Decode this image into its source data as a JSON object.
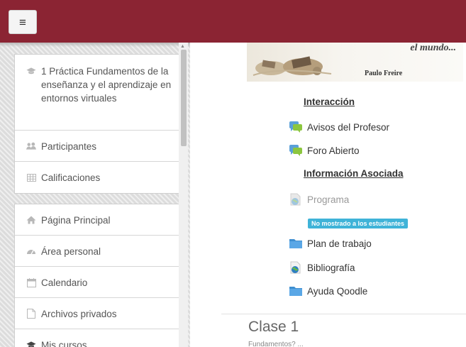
{
  "topbar": {
    "menu_icon": "hamburger-icon",
    "menu_glyph": "≡",
    "color": "#8b2433"
  },
  "sidebar": {
    "course_block": [
      {
        "label": "1 Práctica Fundamentos de la enseñanza y el aprendizaje en entornos virtuales",
        "icon": "graduation-cap-icon"
      },
      {
        "label": "Participantes",
        "icon": "users-icon"
      },
      {
        "label": "Calificaciones",
        "icon": "table-icon"
      }
    ],
    "nav_block": [
      {
        "label": "Página Principal",
        "icon": "home-icon"
      },
      {
        "label": "Área personal",
        "icon": "dashboard-icon"
      },
      {
        "label": "Calendario",
        "icon": "calendar-icon"
      },
      {
        "label": "Archivos privados",
        "icon": "file-icon"
      },
      {
        "label": "Mis cursos",
        "icon": "graduation-cap-icon"
      }
    ]
  },
  "main": {
    "banner": {
      "quote": "el mundo...",
      "author": "Paulo Freire"
    },
    "heading_interaction": "Interacción",
    "forum_items": [
      {
        "label": "Avisos del Profesor",
        "icon": "forum-icon"
      },
      {
        "label": "Foro Abierto",
        "icon": "forum-icon"
      }
    ],
    "heading_info": "Información Asociada",
    "programa": {
      "label": "Programa",
      "icon": "url-globe-icon",
      "badge": "No mostrado a los estudiantes"
    },
    "resource_items": [
      {
        "label": "Plan de trabajo",
        "icon": "folder-icon"
      },
      {
        "label": "Bibliografía",
        "icon": "url-globe-icon"
      },
      {
        "label": "Ayuda Qoodle",
        "icon": "folder-icon"
      }
    ],
    "section": {
      "title": "Clase 1",
      "subtitle": "Fundamentos? ..."
    }
  }
}
